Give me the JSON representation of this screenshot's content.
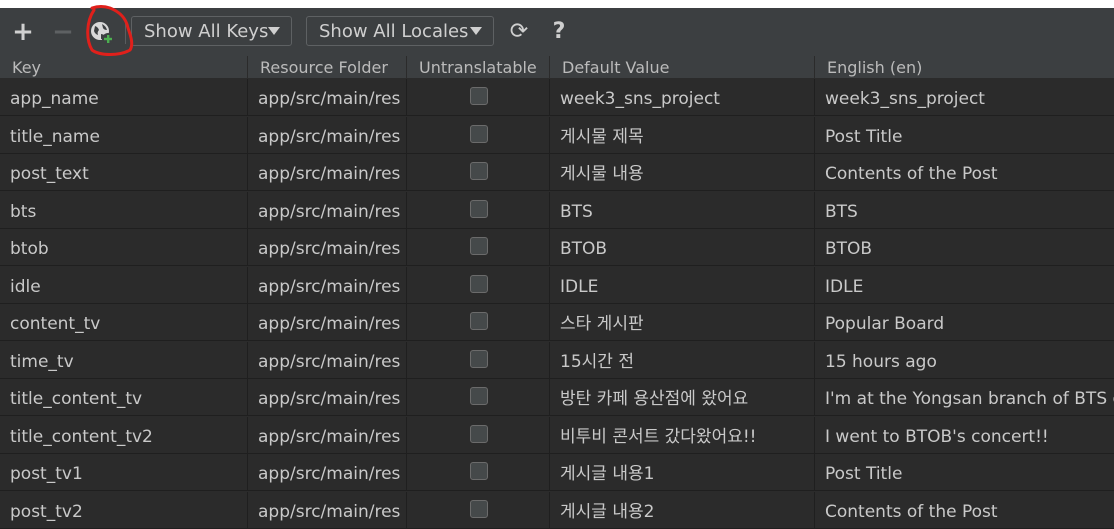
{
  "toolbar": {
    "add_icon": "plus-icon",
    "add_glyph": "+",
    "remove_icon": "minus-icon",
    "remove_glyph": "−",
    "add_locale_icon": "globe-add-icon",
    "keys_filter": "Show All Keys",
    "locales_filter": "Show All Locales",
    "refresh_icon": "refresh-icon",
    "refresh_glyph": "⟳",
    "help_glyph": "?"
  },
  "columns": [
    "Key",
    "Resource Folder",
    "Untranslatable",
    "Default Value",
    "English (en)"
  ],
  "rows": [
    {
      "key": "app_name",
      "folder": "app/src/main/res",
      "default": "week3_sns_project",
      "en": "week3_sns_project"
    },
    {
      "key": "title_name",
      "folder": "app/src/main/res",
      "default": "게시물 제목",
      "en": "Post Title"
    },
    {
      "key": "post_text",
      "folder": "app/src/main/res",
      "default": "게시물 내용",
      "en": "Contents of the Post"
    },
    {
      "key": "bts",
      "folder": "app/src/main/res",
      "default": "BTS",
      "en": "BTS"
    },
    {
      "key": "btob",
      "folder": "app/src/main/res",
      "default": "BTOB",
      "en": "BTOB"
    },
    {
      "key": "idle",
      "folder": "app/src/main/res",
      "default": "IDLE",
      "en": "IDLE"
    },
    {
      "key": "content_tv",
      "folder": "app/src/main/res",
      "default": "스타 게시판",
      "en": "Popular Board"
    },
    {
      "key": "time_tv",
      "folder": "app/src/main/res",
      "default": "15시간 전",
      "en": "15 hours ago"
    },
    {
      "key": "title_content_tv",
      "folder": "app/src/main/res",
      "default": "방탄 카페 용산점에 왔어요",
      "en": "I'm at the Yongsan branch of BTS ca"
    },
    {
      "key": "title_content_tv2",
      "folder": "app/src/main/res",
      "default": "비투비 콘서트 갔다왔어요!!",
      "en": "I went to BTOB's concert!!"
    },
    {
      "key": "post_tv1",
      "folder": "app/src/main/res",
      "default": "게시글 내용1",
      "en": "Post Title"
    },
    {
      "key": "post_tv2",
      "folder": "app/src/main/res",
      "default": "게시글 내용2",
      "en": "Contents of the Post"
    }
  ],
  "colors": {
    "background": "#2b2b2b",
    "toolbar": "#3c3f41",
    "annotation": "#e0201b"
  }
}
